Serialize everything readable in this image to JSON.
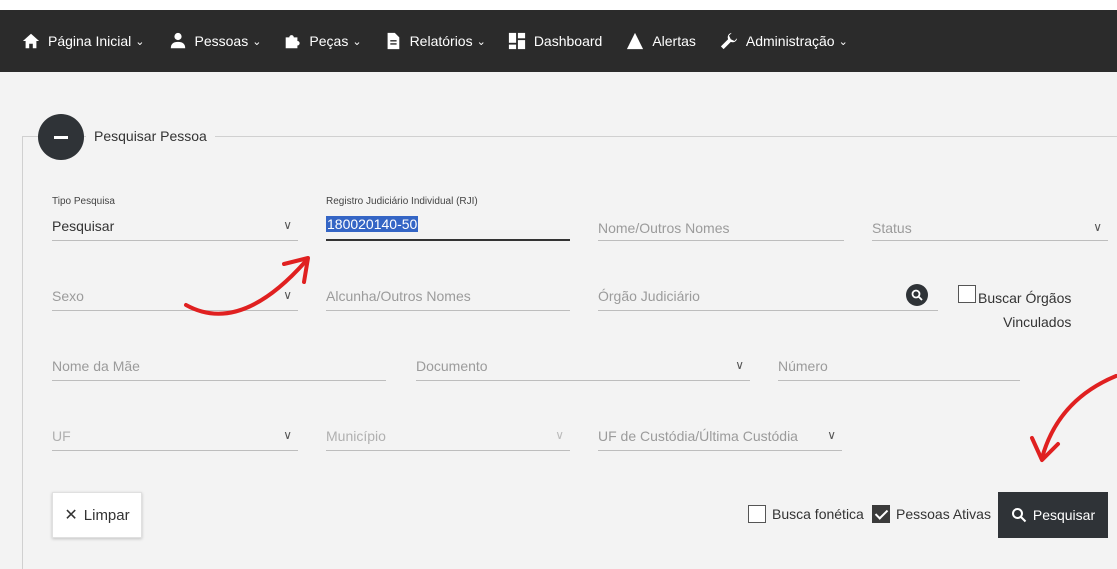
{
  "nav": {
    "items": [
      {
        "label": "Página Inicial",
        "icon": "home-icon",
        "dropdown": true
      },
      {
        "label": "Pessoas",
        "icon": "person-icon",
        "dropdown": true
      },
      {
        "label": "Peças",
        "icon": "puzzle-icon",
        "dropdown": true
      },
      {
        "label": "Relatórios",
        "icon": "document-icon",
        "dropdown": true
      },
      {
        "label": "Dashboard",
        "icon": "dashboard-icon",
        "dropdown": false
      },
      {
        "label": "Alertas",
        "icon": "warning-icon",
        "dropdown": false
      },
      {
        "label": "Administração",
        "icon": "wrench-icon",
        "dropdown": true
      }
    ]
  },
  "panel": {
    "legend": "Pesquisar Pessoa"
  },
  "form": {
    "tipo_pesquisa": {
      "label": "Tipo Pesquisa",
      "value": "Pesquisar"
    },
    "rji": {
      "label": "Registro Judiciário Individual (RJI)",
      "value": "180020140-50"
    },
    "nome": {
      "placeholder": "Nome/Outros Nomes"
    },
    "status": {
      "placeholder": "Status"
    },
    "sexo": {
      "placeholder": "Sexo"
    },
    "alcunha": {
      "placeholder": "Alcunha/Outros Nomes"
    },
    "orgao": {
      "placeholder": "Órgão Judiciário"
    },
    "buscar_orgaos": {
      "label_line1": "Buscar Órgãos",
      "label_line2": "Vinculados",
      "checked": false
    },
    "nome_mae": {
      "placeholder": "Nome da Mãe"
    },
    "documento": {
      "placeholder": "Documento"
    },
    "numero": {
      "placeholder": "Número"
    },
    "uf": {
      "placeholder": "UF"
    },
    "municipio": {
      "placeholder": "Município"
    },
    "uf_custodia": {
      "placeholder": "UF de Custódia/Última Custódia"
    }
  },
  "actions": {
    "clear_label": "Limpar",
    "busca_fonetica": {
      "label": "Busca fonética",
      "checked": false
    },
    "pessoas_ativas": {
      "label": "Pessoas Ativas",
      "checked": true
    },
    "search_label": "Pesquisar"
  },
  "colors": {
    "navbar": "#2b2b2b",
    "accent": "#2f3337",
    "arrow": "#e02020",
    "selection": "#3465c5"
  }
}
